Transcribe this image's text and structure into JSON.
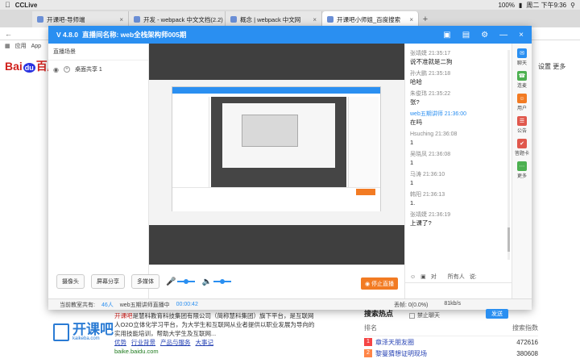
{
  "menubar": {
    "app_name": "CCLive",
    "battery": "100%",
    "clock": "周二 下午9:36"
  },
  "tabs": [
    {
      "label": "开课吧-导师端",
      "active": false
    },
    {
      "label": "开发 - webpack 中文文档(2.2)",
      "active": false
    },
    {
      "label": "概念 | webpack 中文网",
      "active": false
    },
    {
      "label": "开课吧小师姐_百度搜索",
      "active": true
    }
  ],
  "bookmarks": {
    "apps": "应用",
    "app2": "App"
  },
  "baidu": {
    "logo": "Bai",
    "logo_du": "du",
    "logo_end": "百度",
    "settings": "设置",
    "more": "更多",
    "brand": "开课吧",
    "brand_sub": "kaikeba.com",
    "encyc_hl": "开课吧",
    "encyc_text": "是慧科教育科技集团有限公司（简称慧科集团）旗下平台，是互联网人O2O立体化学习平台，为大学生和互联网从业者提供以职业发展为导向的实用技能培训，帮助大学生及互联网...",
    "encyc_links": [
      "优势",
      "行业背景",
      "产品与服务",
      "大事记"
    ],
    "encyc_url": "baike.baidu.com",
    "hot_title": "搜索热点",
    "hot_col_rank": "排名",
    "hot_col_index": "搜索指数",
    "hot_items": [
      {
        "rank": "1",
        "title": "章泽天朋友圈",
        "index": "472616"
      },
      {
        "rank": "2",
        "title": "黎曼猜想证明现场",
        "index": "380608"
      }
    ]
  },
  "modal": {
    "version": "V 4.8.0",
    "title": "直播间名称: web全栈架构师005期",
    "left": {
      "section": "直播场景",
      "scene": "桌面共享 1"
    },
    "controls": {
      "camera": "摄像头",
      "screen_share": "屏幕分享",
      "media": "多媒体",
      "stop": "停止直播"
    },
    "status": {
      "online_label": "当前教室共有:",
      "online_count": "46人",
      "live_label": "web五期讲师直播中",
      "live_time": "00:00:42",
      "loss": "丢帧: 0(0.0%)",
      "bitrate": "81kb/s"
    },
    "chat": {
      "messages": [
        {
          "user": "张靖婕 21:35:17",
          "text": "说不准就是二狗",
          "teacher": false
        },
        {
          "user": "孙大鹏 21:35:18",
          "text": "哈哈",
          "teacher": false
        },
        {
          "user": "朱俊玮 21:35:22",
          "text": "张?",
          "teacher": false
        },
        {
          "user": "web五期讲师 21:36:00",
          "text": "在吗",
          "teacher": true
        },
        {
          "user": "Hsuching 21:36:08",
          "text": "1",
          "teacher": false
        },
        {
          "user": "吴晓凤 21:36:08",
          "text": "1",
          "teacher": false
        },
        {
          "user": "马涛 21:36:10",
          "text": "1",
          "teacher": false
        },
        {
          "user": "韩阳 21:36:13",
          "text": "1.",
          "teacher": false
        },
        {
          "user": "张靖婕 21:36:19",
          "text": "上课了?",
          "teacher": false
        }
      ],
      "to_label": "对",
      "to_target": "所有人",
      "say_label": "说:",
      "input_value": "",
      "mute": "禁止聊天",
      "send": "发送"
    },
    "rail": [
      {
        "label": "聊天",
        "color": "#2a8ff1",
        "icon": "chat-icon"
      },
      {
        "label": "连麦",
        "color": "#4cb050",
        "icon": "mic-link-icon"
      },
      {
        "label": "用户",
        "color": "#f27b23",
        "icon": "user-icon"
      },
      {
        "label": "公告",
        "color": "#e0584d",
        "icon": "notice-icon"
      },
      {
        "label": "答题卡",
        "color": "#e0584d",
        "icon": "quiz-icon"
      },
      {
        "label": "更多",
        "color": "#4cb050",
        "icon": "more-icon"
      }
    ]
  }
}
